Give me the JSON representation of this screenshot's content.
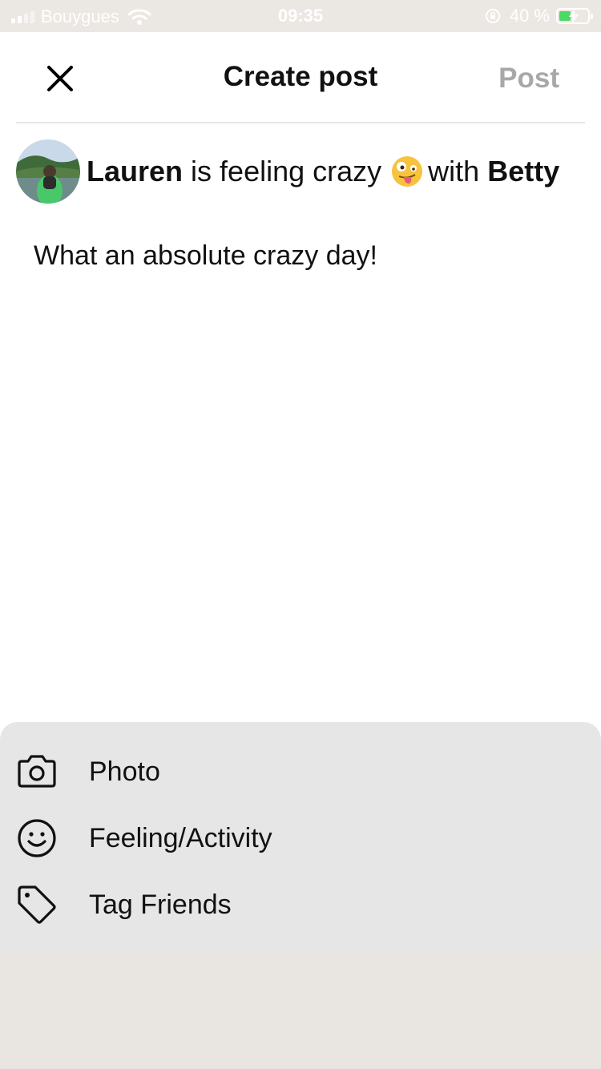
{
  "status_bar": {
    "carrier": "Bouygues",
    "time": "09:35",
    "battery_percent": "40 %",
    "battery_level": 0.4
  },
  "header": {
    "title": "Create post",
    "post_label": "Post"
  },
  "author": {
    "name": "Lauren",
    "feeling_text": "is feeling crazy",
    "with_text": "with",
    "tagged": "Betty"
  },
  "post": {
    "text": "What an absolute crazy day!"
  },
  "actions": [
    {
      "label": "Photo",
      "icon": "camera-icon"
    },
    {
      "label": "Feeling/Activity",
      "icon": "smiley-icon"
    },
    {
      "label": "Tag Friends",
      "icon": "tag-icon"
    }
  ],
  "colors": {
    "post_disabled": "#a8a8a8",
    "sheet_bg": "#e6e6e6"
  }
}
